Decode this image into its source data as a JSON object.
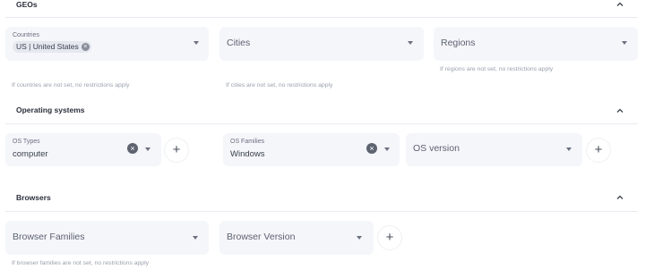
{
  "geos": {
    "title": "GEOs",
    "countries": {
      "label": "Countries",
      "chip": "US | United States",
      "hint": "If countries are not set, no restrictions apply"
    },
    "cities": {
      "placeholder": "Cities",
      "hint": "If cities are not set, no restrictions apply"
    },
    "regions": {
      "placeholder": "Regions",
      "hint": "If regions are not set, no restrictions apply"
    }
  },
  "os": {
    "title": "Operating systems",
    "types": {
      "label": "OS Types",
      "value": "computer"
    },
    "families": {
      "label": "OS Families",
      "value": "Windows"
    },
    "version": {
      "placeholder": "OS version"
    },
    "add_label": "+"
  },
  "browsers": {
    "title": "Browsers",
    "families": {
      "placeholder": "Browser Families",
      "hint": "If browser families are not set, no restrictions apply"
    },
    "version": {
      "placeholder": "Browser Version"
    },
    "add_label": "+"
  },
  "icons": {
    "collapse": "chevron-up-icon",
    "dropdown": "caret-down-icon",
    "clear": "clear-icon",
    "add": "plus-icon"
  }
}
